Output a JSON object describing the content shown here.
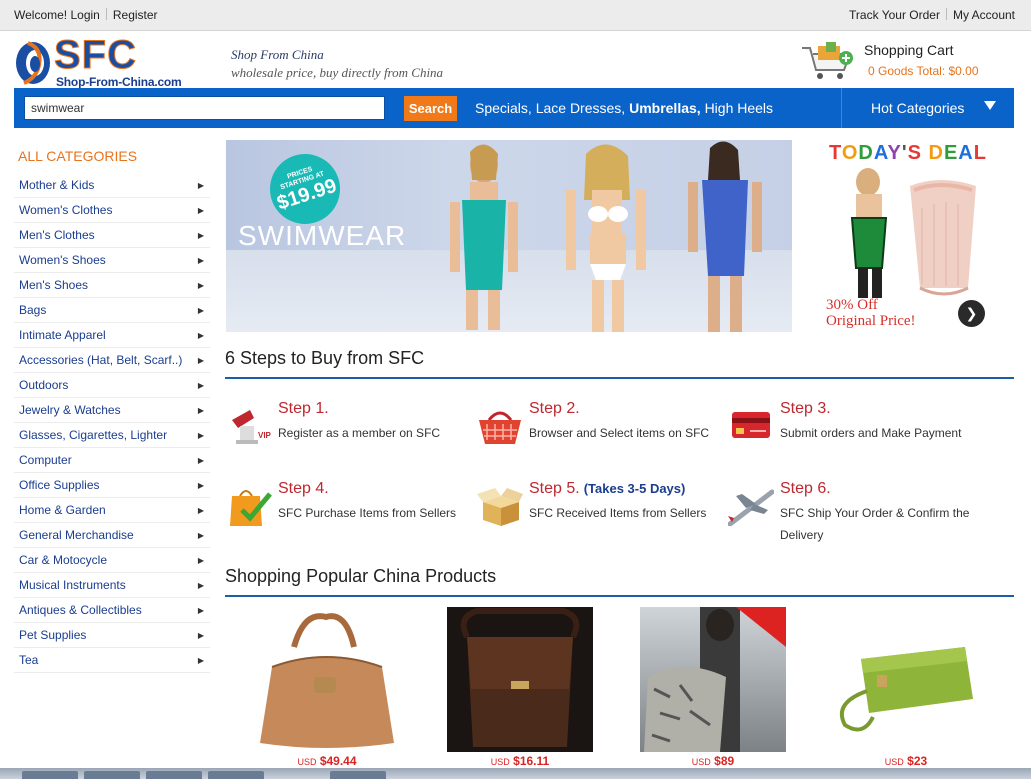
{
  "topbar": {
    "welcome": "Welcome!",
    "login": "Login",
    "register": "Register",
    "track_order": "Track Your Order",
    "my_account": "My Account"
  },
  "header": {
    "logo_text": "SFC",
    "logo_site": "Shop-From-China.com",
    "slogan_line1": "Shop From China",
    "slogan_line2": "wholesale price, buy directly from China",
    "cart_title": "Shopping Cart",
    "cart_info": "0 Goods Total: $0.00"
  },
  "nav": {
    "search_value": "swimwear",
    "search_button": "Search",
    "links": [
      {
        "label": "Specials,",
        "bold": false
      },
      {
        "label": "Lace Dresses,",
        "bold": false
      },
      {
        "label": "Umbrellas,",
        "bold": true
      },
      {
        "label": "High Heels",
        "bold": false
      }
    ],
    "hot_categories": "Hot Categories"
  },
  "sidebar": {
    "heading": "ALL CATEGORIES",
    "items": [
      "Mother & Kids",
      "Women's Clothes",
      "Men's Clothes",
      "Women's Shoes",
      "Men's Shoes",
      "Bags",
      "Intimate Apparel",
      "Accessories (Hat, Belt, Scarf..)",
      "Outdoors",
      "Jewelry & Watches",
      "Glasses, Cigarettes, Lighter",
      "Computer",
      "Office Supplies",
      "Home & Garden",
      "General Merchandise",
      "Car & Motocycle",
      "Musical Instruments",
      "Antiques & Collectibles",
      "Pet Supplies",
      "Tea"
    ]
  },
  "banner": {
    "word": "SWIMWEAR",
    "badge_line1": "PRICES",
    "badge_line2": "STARTING AT",
    "badge_price": "$19.99"
  },
  "deal": {
    "title_letters": [
      "T",
      "O",
      "D",
      "A",
      "Y",
      "'",
      "S",
      " ",
      "D",
      "E",
      "A",
      "L"
    ],
    "title_colors": [
      "#e53935",
      "#f39c12",
      "#2e9e3b",
      "#1e6fd9",
      "#8e44ad",
      "#555",
      "#e53935",
      "#fff",
      "#f39c12",
      "#2e9e3b",
      "#1e6fd9",
      "#e53935"
    ],
    "off_line1": "30% Off",
    "off_line2": "Original Price!"
  },
  "steps": {
    "title": "6 Steps to Buy from SFC",
    "items": [
      {
        "name": "Step 1.",
        "note": "",
        "desc": "Register as a member on SFC"
      },
      {
        "name": "Step 2.",
        "note": "",
        "desc": "Browser and Select items on SFC"
      },
      {
        "name": "Step 3.",
        "note": "",
        "desc": "Submit orders and Make Payment"
      },
      {
        "name": "Step 4.",
        "note": "",
        "desc": "SFC Purchase Items from Sellers"
      },
      {
        "name": "Step 5.",
        "note": "(Takes 3-5 Days)",
        "desc": "SFC Received Items from Sellers"
      },
      {
        "name": "Step 6.",
        "note": "",
        "desc": "SFC Ship Your Order & Confirm the Delivery"
      }
    ]
  },
  "products": {
    "title": "Shopping Popular China Products",
    "items": [
      {
        "currency": "USD",
        "price": "$49.44"
      },
      {
        "currency": "USD",
        "price": "$16.11"
      },
      {
        "currency": "USD",
        "price": "$89"
      },
      {
        "currency": "USD",
        "price": "$23"
      }
    ]
  },
  "colors": {
    "nav_blue": "#0a63c9",
    "accent_orange": "#f07a1a",
    "step_red": "#c0262d",
    "link_blue": "#1a3d8f"
  }
}
